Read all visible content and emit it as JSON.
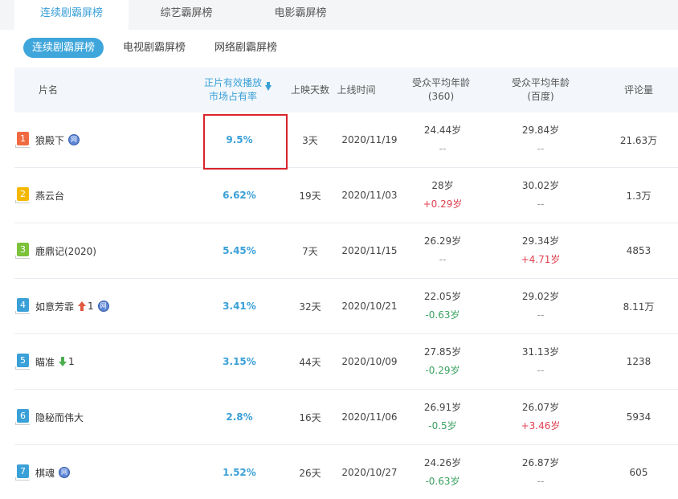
{
  "top_tabs": [
    "连续剧霸屏榜",
    "综艺霸屏榜",
    "电影霸屏榜"
  ],
  "sub_tabs": [
    "连续剧霸屏榜",
    "电视剧霸屏榜",
    "网络剧霸屏榜"
  ],
  "columns": {
    "name": "片名",
    "share_line1": "正片有效播放",
    "share_line2": "市场占有率",
    "days": "上映天数",
    "date": "上线时间",
    "age360_line1": "受众平均年龄",
    "age360_line2": "(360)",
    "agebd_line1": "受众平均年龄",
    "agebd_line2": "(百度)",
    "comments": "评论量"
  },
  "colors": {
    "accent": "#3aa0d8",
    "rank_colors": [
      "#f06a40",
      "#f5b800",
      "#7cc23a",
      "#3aa0d8",
      "#3aa0d8",
      "#3aa0d8",
      "#3aa0d8"
    ],
    "highlight": "#d9242b"
  },
  "rows": [
    {
      "rank": "1",
      "title": "狼殿下",
      "badge": "网",
      "trend": "",
      "trend_num": "",
      "share": "9.5%",
      "days": "3天",
      "date": "2020/11/19",
      "age360": "24.44岁",
      "age360_delta": "--",
      "agebd": "29.84岁",
      "agebd_delta": "--",
      "comments": "21.63万"
    },
    {
      "rank": "2",
      "title": "燕云台",
      "badge": "",
      "trend": "",
      "trend_num": "",
      "share": "6.62%",
      "days": "19天",
      "date": "2020/11/03",
      "age360": "28岁",
      "age360_delta": "+0.29岁",
      "agebd": "30.02岁",
      "agebd_delta": "--",
      "comments": "1.3万"
    },
    {
      "rank": "3",
      "title": "鹿鼎记(2020)",
      "badge": "",
      "trend": "",
      "trend_num": "",
      "share": "5.45%",
      "days": "7天",
      "date": "2020/11/15",
      "age360": "26.29岁",
      "age360_delta": "--",
      "agebd": "29.34岁",
      "agebd_delta": "+4.71岁",
      "comments": "4853"
    },
    {
      "rank": "4",
      "title": "如意芳霏",
      "badge": "网",
      "trend": "up",
      "trend_num": "1",
      "share": "3.41%",
      "days": "32天",
      "date": "2020/10/21",
      "age360": "22.05岁",
      "age360_delta": "-0.63岁",
      "agebd": "29.02岁",
      "agebd_delta": "--",
      "comments": "8.11万"
    },
    {
      "rank": "5",
      "title": "瞄准",
      "badge": "",
      "trend": "down",
      "trend_num": "1",
      "share": "3.15%",
      "days": "44天",
      "date": "2020/10/09",
      "age360": "27.85岁",
      "age360_delta": "-0.29岁",
      "agebd": "31.13岁",
      "agebd_delta": "--",
      "comments": "1238"
    },
    {
      "rank": "6",
      "title": "隐秘而伟大",
      "badge": "",
      "trend": "",
      "trend_num": "",
      "share": "2.8%",
      "days": "16天",
      "date": "2020/11/06",
      "age360": "26.91岁",
      "age360_delta": "-0.5岁",
      "agebd": "26.07岁",
      "agebd_delta": "+3.46岁",
      "comments": "5934"
    },
    {
      "rank": "7",
      "title": "棋魂",
      "badge": "网",
      "trend": "",
      "trend_num": "",
      "share": "1.52%",
      "days": "26天",
      "date": "2020/10/27",
      "age360": "24.26岁",
      "age360_delta": "-0.63岁",
      "agebd": "26.87岁",
      "agebd_delta": "--",
      "comments": "605"
    }
  ]
}
